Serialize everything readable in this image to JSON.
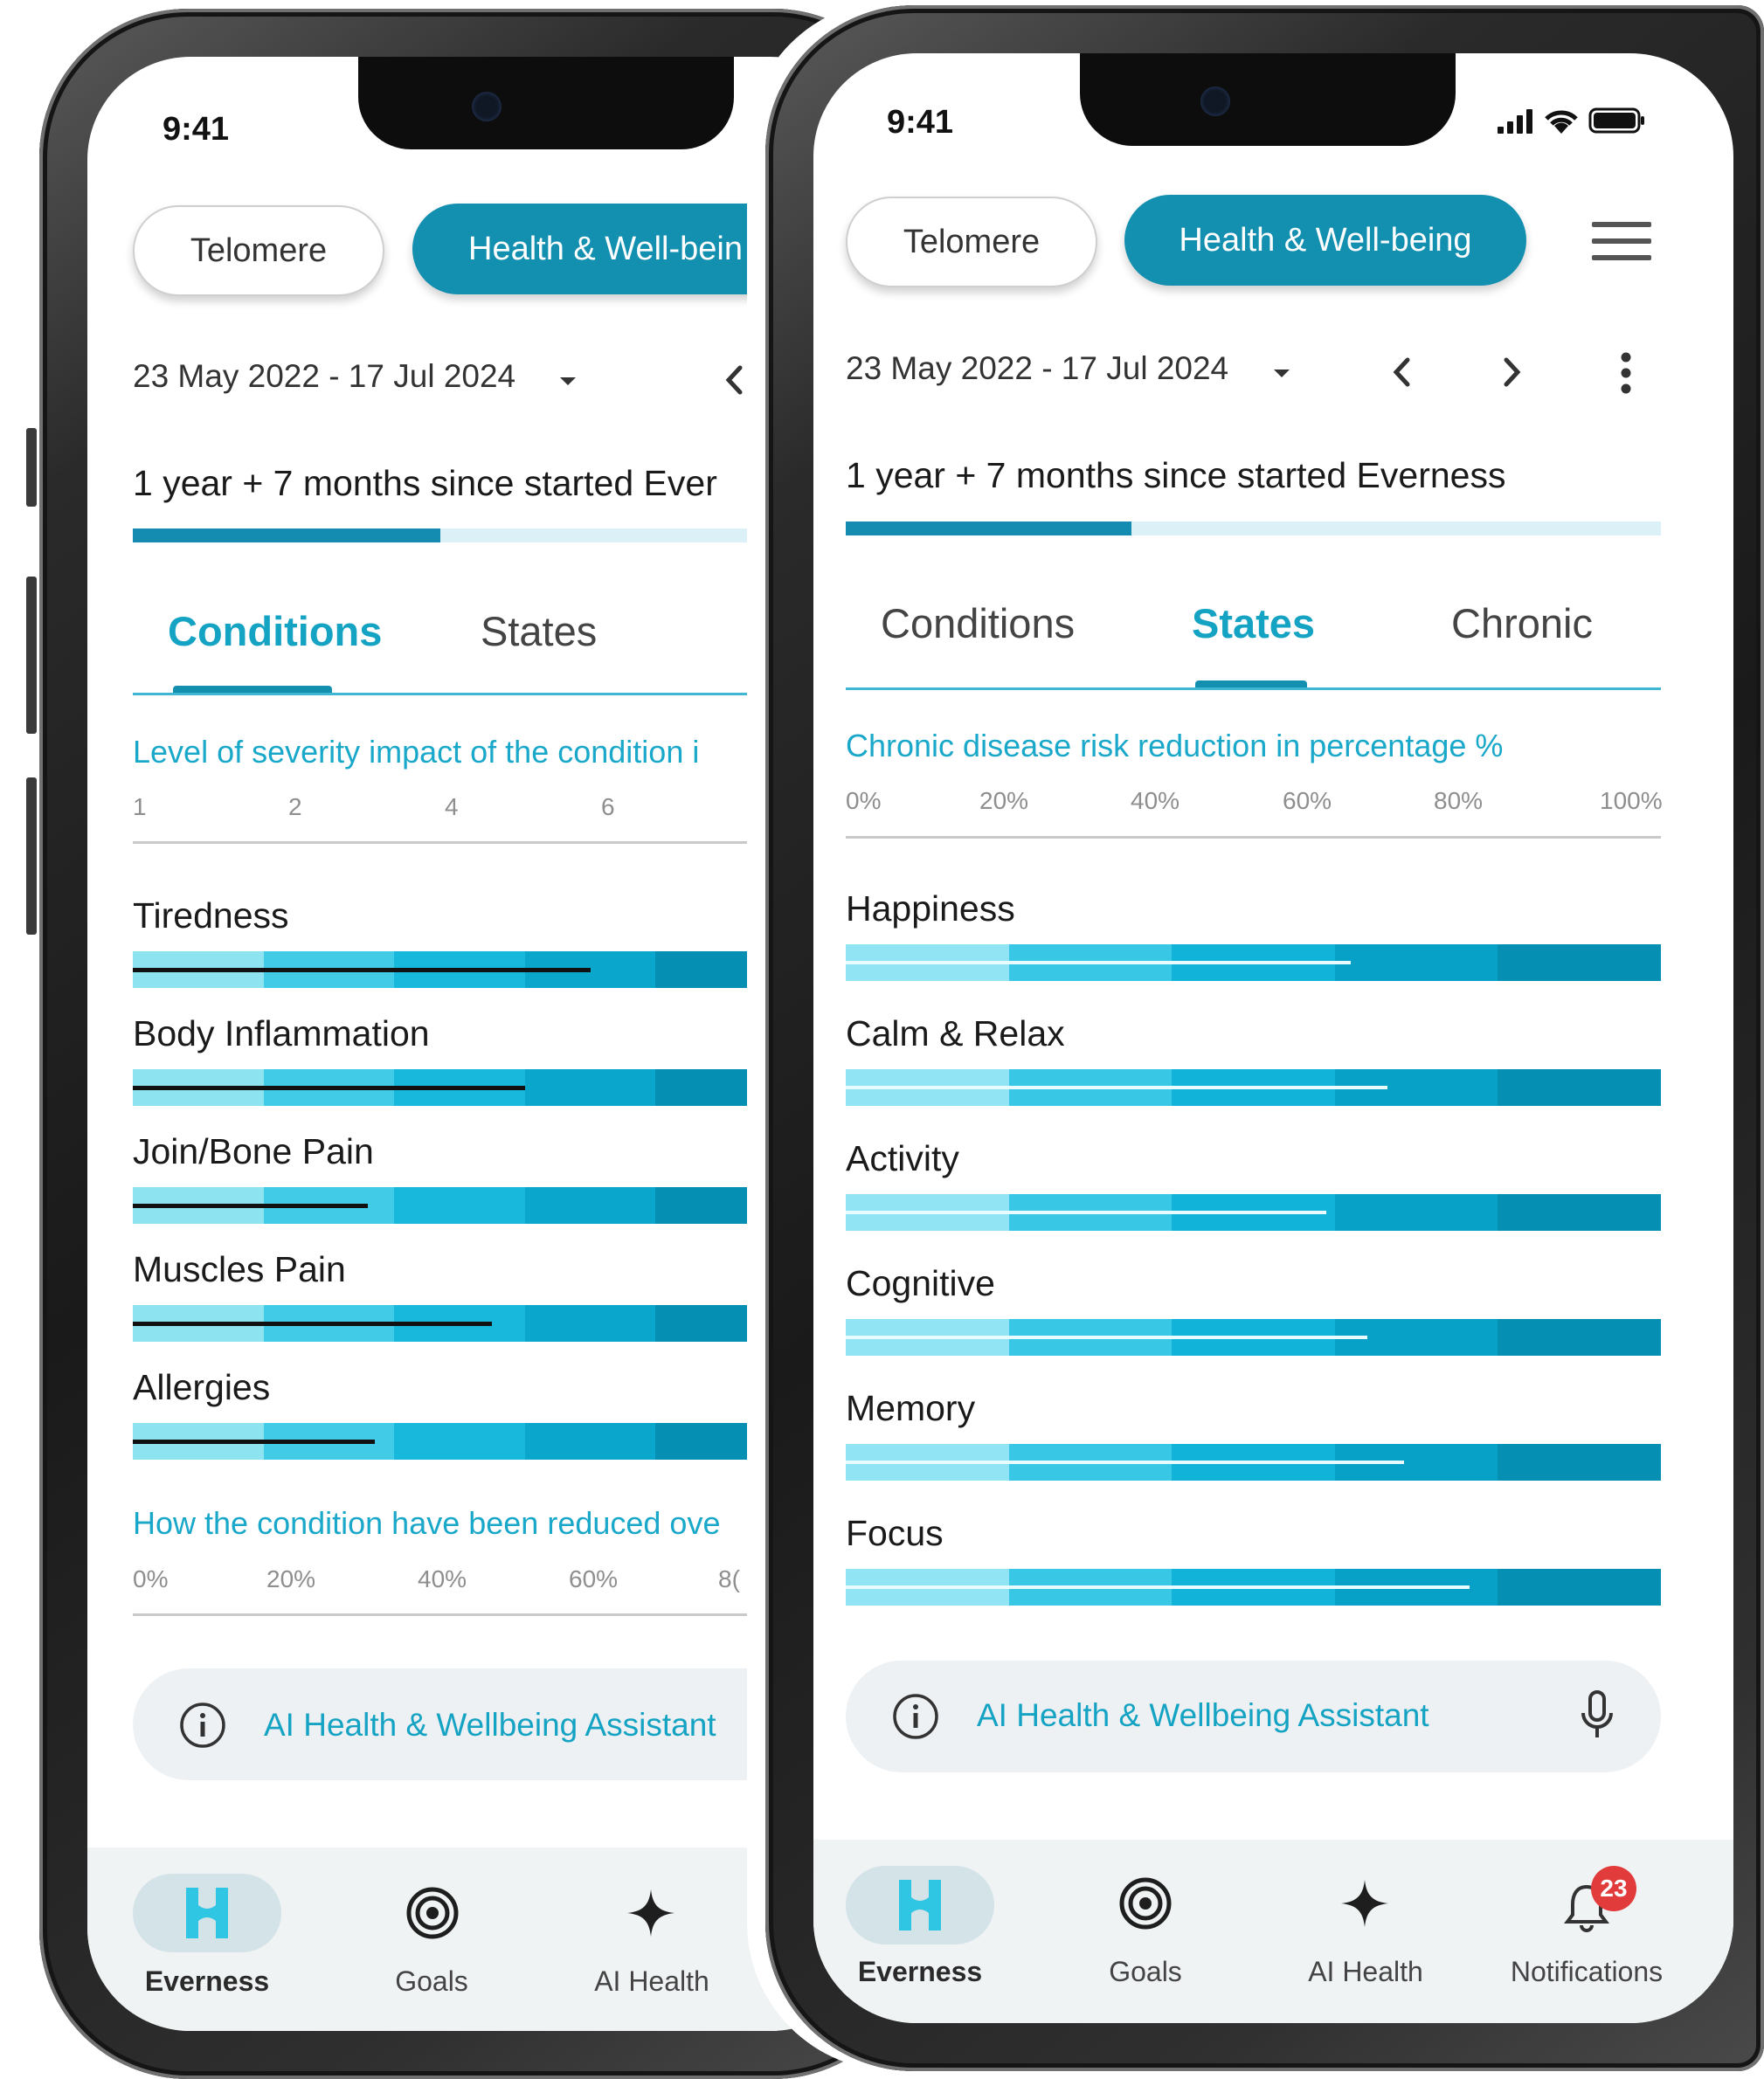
{
  "left": {
    "status_time": "9:41",
    "pill_telomere": "Telomere",
    "pill_health": "Health & Well-bein",
    "date_range": "23 May 2022 - 17 Jul 2024",
    "since_text": "1 year + 7 months since started Ever",
    "progress": 0.47,
    "tabs": [
      "Conditions",
      "States"
    ],
    "active_tab": "Conditions",
    "caption_top": "Level of severity impact of the condition i",
    "scale_ticks": [
      "1",
      "2",
      "4",
      "6"
    ],
    "conditions": [
      {
        "label": "Tiredness",
        "marker": 0.7
      },
      {
        "label": "Body Inflammation",
        "marker": 0.6
      },
      {
        "label": "Join/Bone Pain",
        "marker": 0.36
      },
      {
        "label": "Muscles Pain",
        "marker": 0.55
      },
      {
        "label": "Allergies",
        "marker": 0.37
      }
    ],
    "caption_bottom": "How the condition have been reduced ove",
    "percent_ticks": [
      "0%",
      "20%",
      "40%",
      "60%",
      "8("
    ],
    "assistant": "AI Health & Wellbeing Assistant",
    "nav": [
      "Everness",
      "Goals",
      "AI Health"
    ]
  },
  "right": {
    "status_time": "9:41",
    "pill_telomere": "Telomere",
    "pill_health": "Health & Well-being",
    "date_range": "23 May 2022 - 17 Jul 2024",
    "since_text": "1 year + 7 months since started Everness",
    "progress": 0.35,
    "tabs": [
      "Conditions",
      "States",
      "Chronic"
    ],
    "active_tab": "States",
    "caption_top": "Chronic disease risk reduction in percentage %",
    "percent_ticks": [
      "0%",
      "20%",
      "40%",
      "60%",
      "80%",
      "100%"
    ],
    "states": [
      {
        "label": "Happiness",
        "marker": 0.62
      },
      {
        "label": "Calm & Relax",
        "marker": 0.665
      },
      {
        "label": "Activity",
        "marker": 0.59
      },
      {
        "label": "Cognitive",
        "marker": 0.64
      },
      {
        "label": "Memory",
        "marker": 0.685
      },
      {
        "label": "Focus",
        "marker": 0.765
      }
    ],
    "assistant": "AI Health & Wellbeing Assistant",
    "nav": [
      "Everness",
      "Goals",
      "AI Health",
      "Notifications"
    ],
    "notification_count": "23"
  },
  "colors": {
    "accent": "#138fb0",
    "caption": "#19a8c9",
    "bar_light": "#8ee3f1",
    "bar_dark": "#058fb2",
    "badge": "#e23b3b"
  }
}
